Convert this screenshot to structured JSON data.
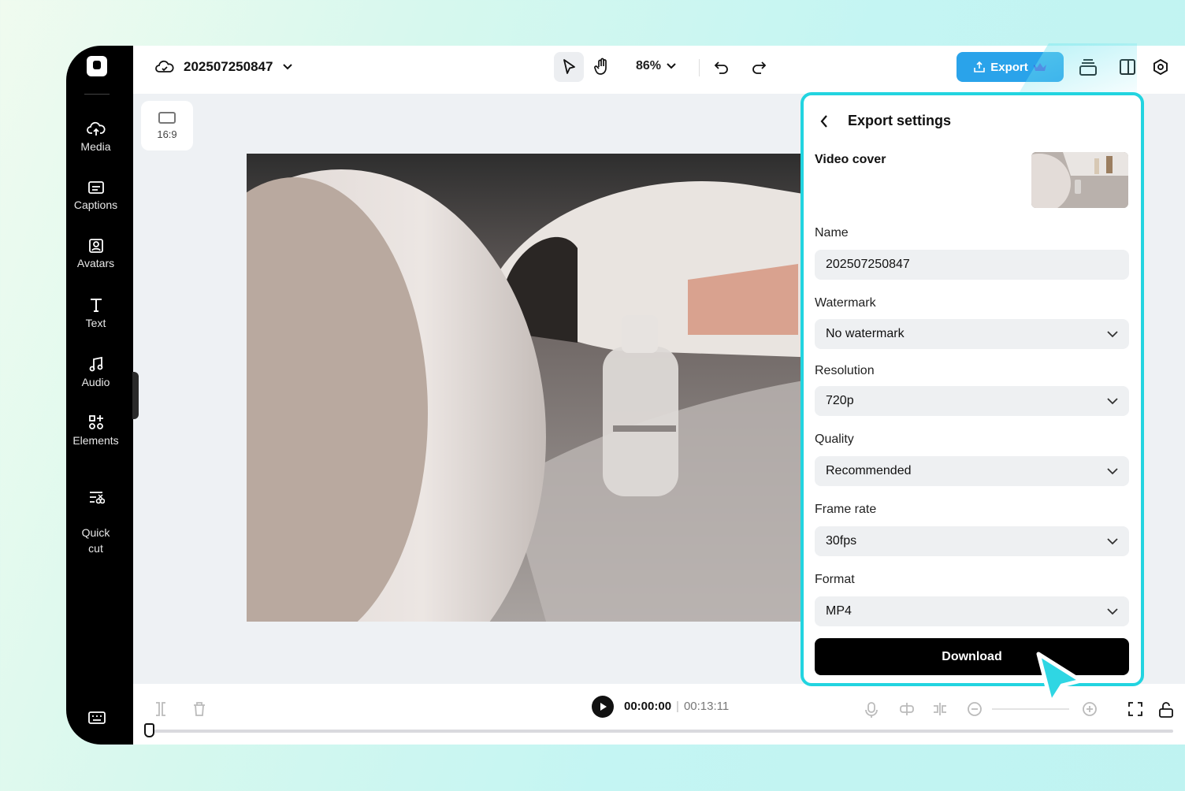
{
  "project": {
    "name": "202507250847"
  },
  "toolbar": {
    "zoom": "86%",
    "export_label": "Export"
  },
  "canvas": {
    "ratio": "16:9"
  },
  "sidebar": {
    "items": [
      {
        "label": "Media",
        "icon": "cloud-upload-icon"
      },
      {
        "label": "Captions",
        "icon": "captions-icon"
      },
      {
        "label": "Avatars",
        "icon": "avatar-icon"
      },
      {
        "label": "Text",
        "icon": "text-icon"
      },
      {
        "label": "Audio",
        "icon": "music-icon"
      },
      {
        "label": "Elements",
        "icon": "elements-icon"
      },
      {
        "label": "Quick\ncut",
        "icon": "quick-cut-icon"
      }
    ]
  },
  "playback": {
    "current": "00:00:00",
    "separator": "|",
    "duration": "00:13:11"
  },
  "export_panel": {
    "title": "Export settings",
    "cover_label": "Video cover",
    "name_label": "Name",
    "name_value": "202507250847",
    "watermark_label": "Watermark",
    "watermark_value": "No watermark",
    "resolution_label": "Resolution",
    "resolution_value": "720p",
    "quality_label": "Quality",
    "quality_value": "Recommended",
    "framerate_label": "Frame rate",
    "framerate_value": "30fps",
    "format_label": "Format",
    "format_value": "MP4",
    "download_label": "Download"
  },
  "colors": {
    "accent": "#2aa3ea",
    "highlight": "#22d4e0",
    "sidebar": "#000000"
  }
}
